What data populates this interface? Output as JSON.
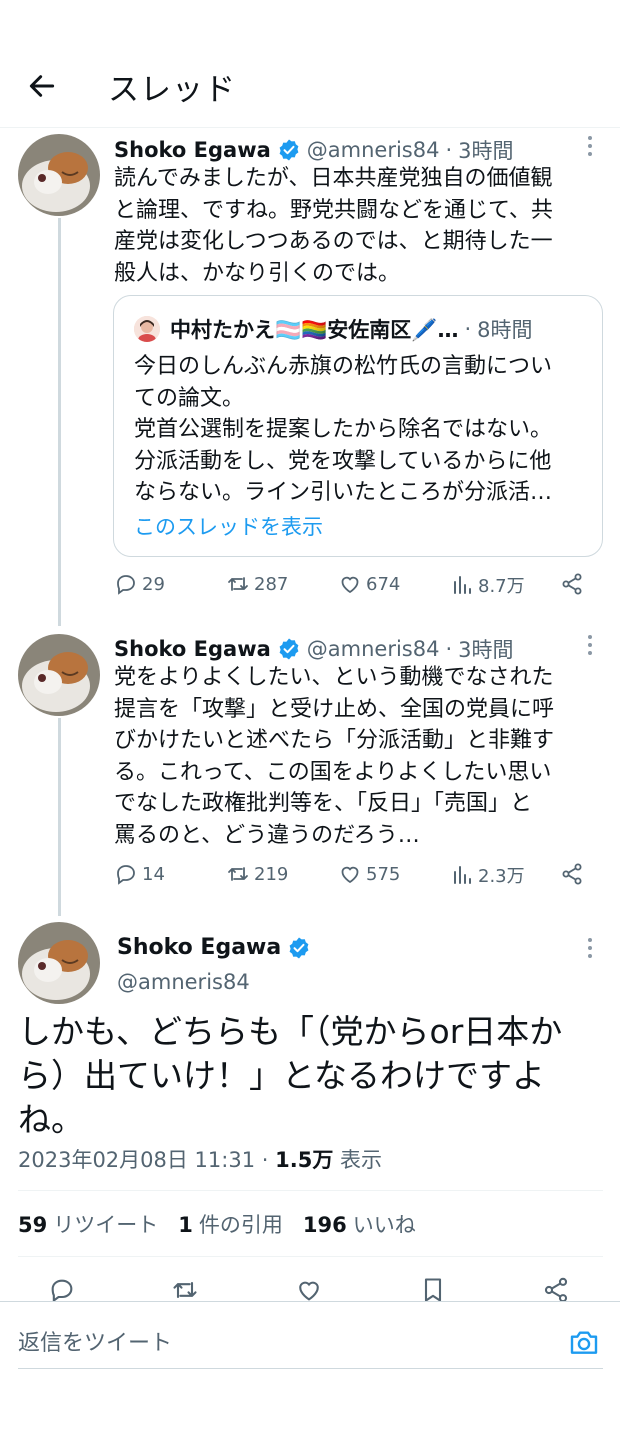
{
  "header": {
    "title": "スレッド",
    "back_icon": "back-arrow-icon"
  },
  "tweets": [
    {
      "name": "Shoko Egawa",
      "handle": "@amneris84",
      "dot": "·",
      "time": "3時間",
      "text": "読んでみましたが、日本共産党独自の価値観\nと論理、ですね。野党共闘などを通じて、共\n産党は変化しつつあるのでは、と期待した一\n般人は、かなり引くのでは。",
      "quote": {
        "name": "中村たかえ🏳️‍⚧️🏳️‍🌈安佐南区🖊️…",
        "dot": "·",
        "time": "8時間",
        "text": "今日のしんぶん赤旗の松竹氏の言動につい\nての論文。\n党首公選制を提案したから除名ではない。\n分派活動をし、党を攻撃しているからに他\nならない。ライン引いたところが分派活…",
        "show_thread": "このスレッドを表示"
      },
      "replies": "29",
      "retweets": "287",
      "likes": "674",
      "views": "8.7万"
    },
    {
      "name": "Shoko Egawa",
      "handle": "@amneris84",
      "dot": "·",
      "time": "3時間",
      "text": "党をよりよくしたい、という動機でなされた\n提言を「攻撃」と受け止め、全国の党員に呼\nびかけたいと述べたら「分派活動」と非難す\nる。これって、この国をよりよくしたい思い\nでなした政権批判等を、「反日」「売国」と\n罵るのと、どう違うのだろう…",
      "replies": "14",
      "retweets": "219",
      "likes": "575",
      "views": "2.3万"
    }
  ],
  "main_tweet": {
    "name": "Shoko Egawa",
    "handle": "@amneris84",
    "text": "しかも、どちらも「（党からor日本か\nら）出ていけ！」となるわけですよ\nね。",
    "timestamp": "2023年02月08日 11:31",
    "dot": "·",
    "views_count": "1.5万",
    "views_label": "表示",
    "retweet_count": "59",
    "retweet_label": "リツイート",
    "quote_count": "1",
    "quote_label": "件の引用",
    "like_count": "196",
    "like_label": "いいね"
  },
  "reply_bar": {
    "placeholder": "返信をツイート"
  },
  "colors": {
    "accent": "#1d9bf0",
    "muted": "#536471",
    "border": "#cfd9de"
  }
}
